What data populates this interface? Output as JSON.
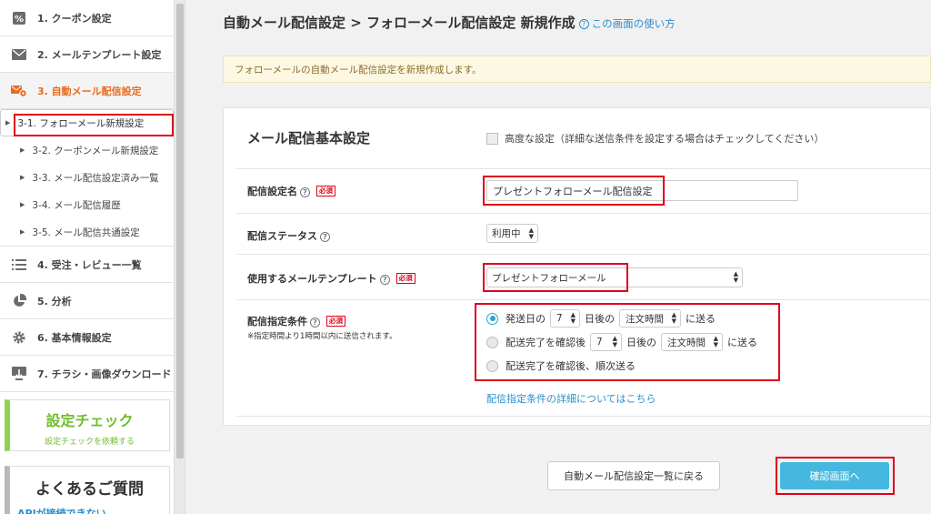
{
  "sidebar": {
    "items": [
      {
        "label": "1. クーポン設定",
        "icon": "coupon-percent-icon"
      },
      {
        "label": "2. メールテンプレート設定",
        "icon": "envelope-icon"
      },
      {
        "label": "3. 自動メール配信設定",
        "icon": "mail-gear-icon"
      }
    ],
    "sub_items": [
      {
        "label": "3-1. フォローメール新規設定"
      },
      {
        "label": "3-2. クーポンメール新規設定"
      },
      {
        "label": "3-3. メール配信設定済み一覧"
      },
      {
        "label": "3-4. メール配信履歴"
      },
      {
        "label": "3-5. メール配信共通設定"
      }
    ],
    "items_after": [
      {
        "label": "4. 受注・レビュー一覧",
        "icon": "list-icon"
      },
      {
        "label": "5. 分析",
        "icon": "pie-chart-icon"
      },
      {
        "label": "6. 基本情報設定",
        "icon": "gear-icon"
      },
      {
        "label": "7. チラシ・画像ダウンロード",
        "icon": "download-icon"
      }
    ],
    "settings_check": {
      "title": "設定チェック",
      "subtitle": "設定チェックを依頼する"
    },
    "faq": {
      "title": "よくあるご質問",
      "item": "APIが接続できない"
    }
  },
  "header": {
    "title": "自動メール配信設定 > フォローメール配信設定 新規作成",
    "help_link": "この画面の使い方"
  },
  "info_bar": "フォローメールの自動メール配信設定を新規作成します。",
  "form": {
    "section_title": "メール配信基本設定",
    "advanced_checkbox": "高度な設定（詳細な送信条件を設定する場合はチェックしてください）",
    "required_badge": "必須",
    "name_label": "配信設定名",
    "name_value": "プレゼントフォローメール配信設定",
    "status_label": "配信ステータス",
    "status_value": "利用中",
    "template_label": "使用するメールテンプレート",
    "template_value": "プレゼントフォローメール",
    "condition_label": "配信指定条件",
    "condition_note": "※指定時間より1時間以内に送信されます。",
    "option1": {
      "pre": "発送日の",
      "days": "7",
      "mid": "日後の",
      "time": "注文時間",
      "post": "に送る"
    },
    "option2": {
      "pre": "配送完了を確認後",
      "days": "7",
      "mid": "日後の",
      "time": "注文時間",
      "post": "に送る"
    },
    "option3": {
      "label": "配送完了を確認後、順次送る"
    },
    "detail_link": "配信指定条件の詳細についてはこちら"
  },
  "buttons": {
    "back": "自動メール配信設定一覧に戻る",
    "confirm": "確認画面へ"
  },
  "colors": {
    "accent": "#e86b1f",
    "link": "#2a8fcc",
    "primary_button": "#46b8e0",
    "highlight_frame": "#e0001b"
  }
}
